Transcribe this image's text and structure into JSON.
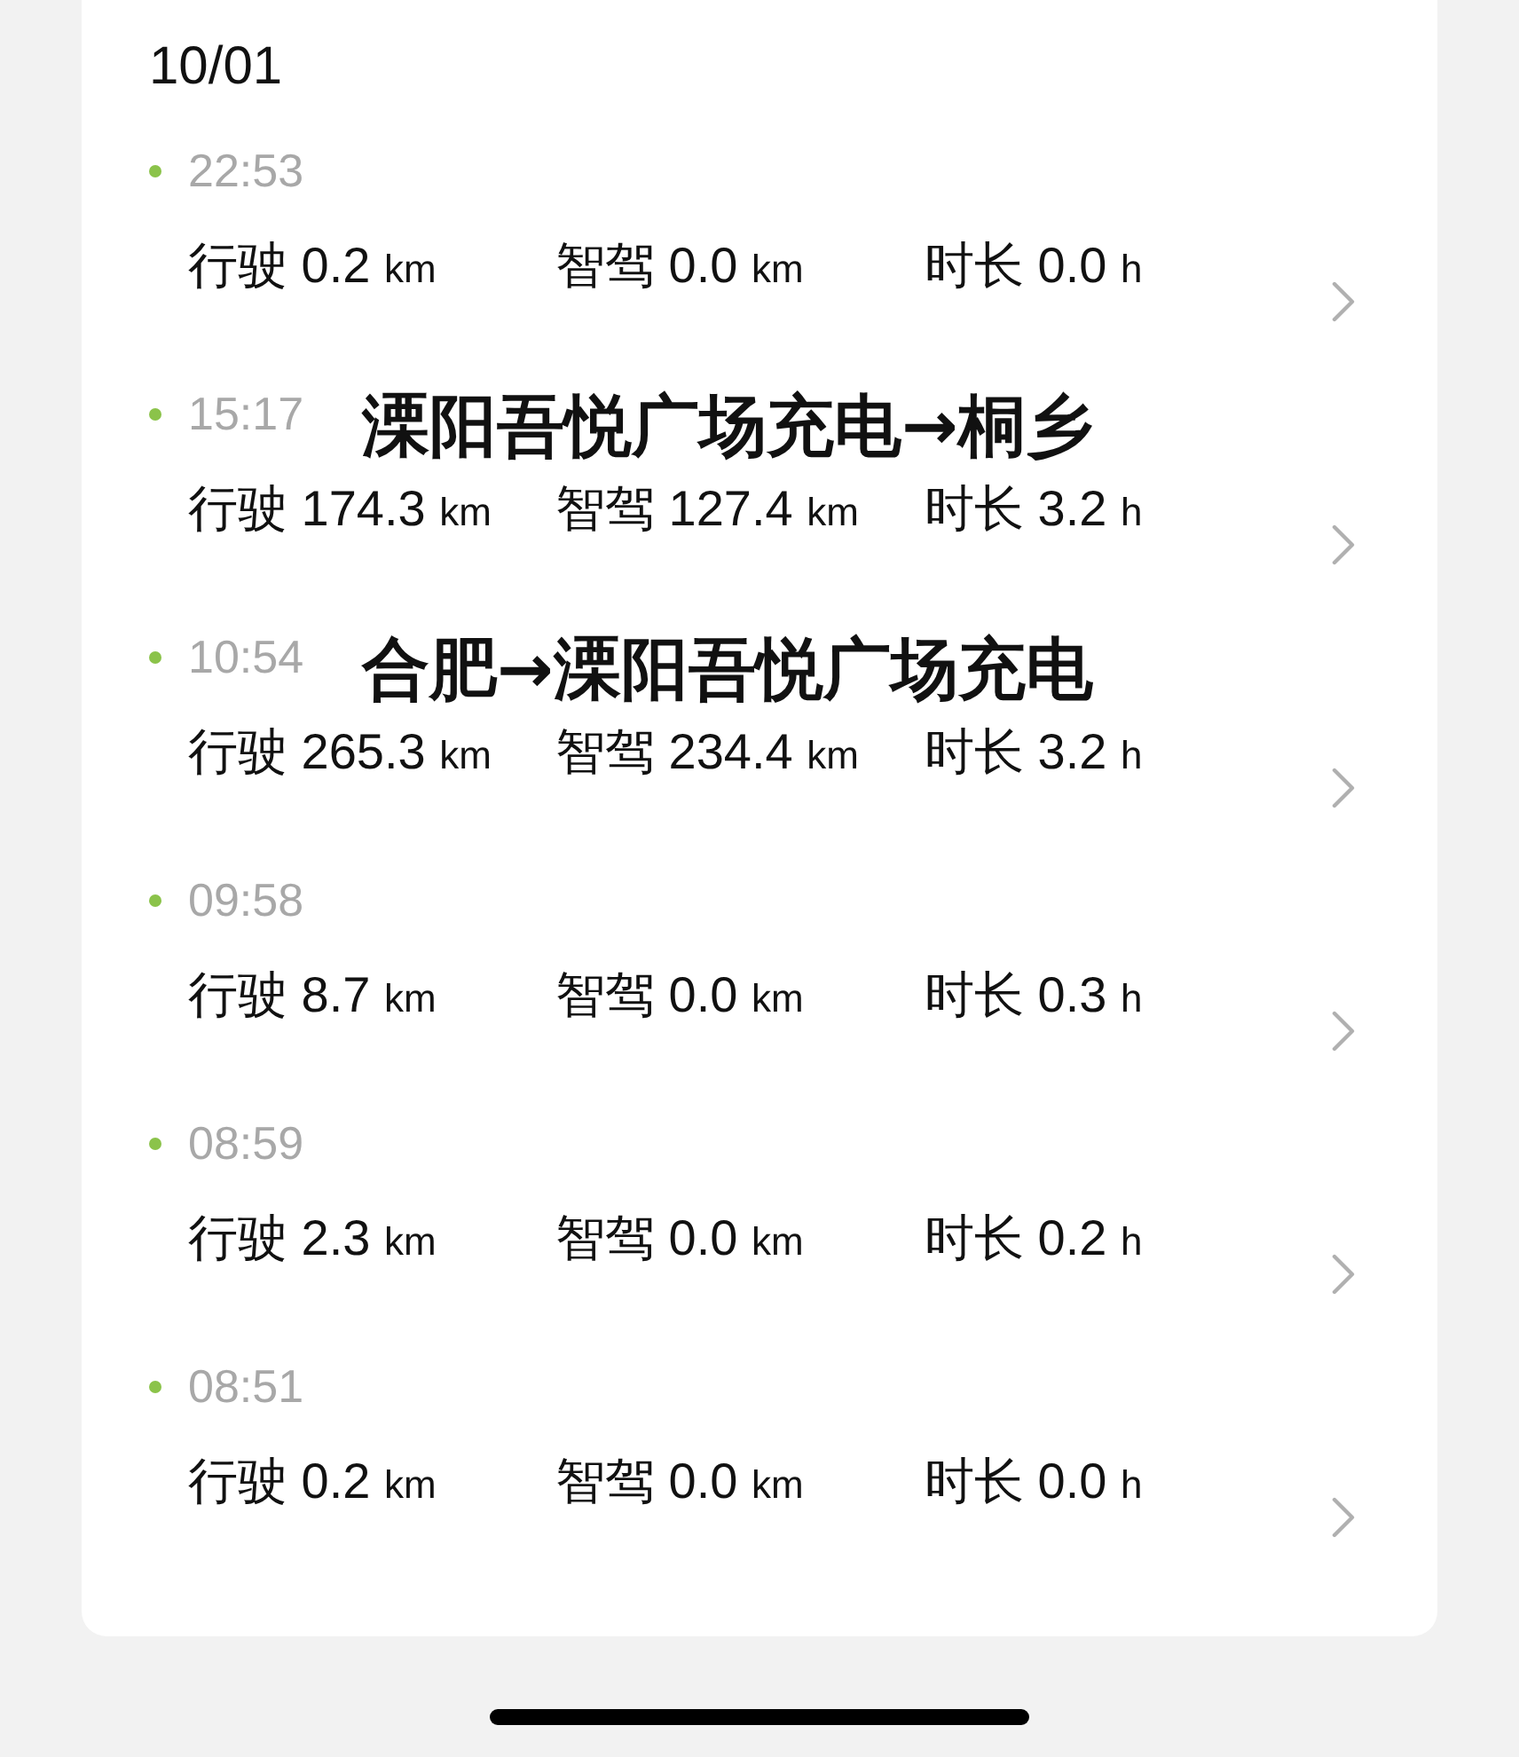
{
  "date": "10/01",
  "trips": [
    {
      "time": "22:53",
      "drive_label": "行驶",
      "drive": "0.2",
      "drive_unit": "km",
      "smart_label": "智驾",
      "smart": "0.0",
      "smart_unit": "km",
      "duration_label": "时长",
      "duration": "0.0",
      "duration_unit": "h"
    },
    {
      "time": "15:17",
      "caption": "溧阳吾悦广场充电→桐乡",
      "drive_label": "行驶",
      "drive": "174.3",
      "drive_unit": "km",
      "smart_label": "智驾",
      "smart": "127.4",
      "smart_unit": "km",
      "duration_label": "时长",
      "duration": "3.2",
      "duration_unit": "h"
    },
    {
      "time": "10:54",
      "caption": "合肥→溧阳吾悦广场充电",
      "drive_label": "行驶",
      "drive": "265.3",
      "drive_unit": "km",
      "smart_label": "智驾",
      "smart": "234.4",
      "smart_unit": "km",
      "duration_label": "时长",
      "duration": "3.2",
      "duration_unit": "h"
    },
    {
      "time": "09:58",
      "drive_label": "行驶",
      "drive": "8.7",
      "drive_unit": "km",
      "smart_label": "智驾",
      "smart": "0.0",
      "smart_unit": "km",
      "duration_label": "时长",
      "duration": "0.3",
      "duration_unit": "h"
    },
    {
      "time": "08:59",
      "drive_label": "行驶",
      "drive": "2.3",
      "drive_unit": "km",
      "smart_label": "智驾",
      "smart": "0.0",
      "smart_unit": "km",
      "duration_label": "时长",
      "duration": "0.2",
      "duration_unit": "h"
    },
    {
      "time": "08:51",
      "drive_label": "行驶",
      "drive": "0.2",
      "drive_unit": "km",
      "smart_label": "智驾",
      "smart": "0.0",
      "smart_unit": "km",
      "duration_label": "时长",
      "duration": "0.0",
      "duration_unit": "h"
    }
  ]
}
